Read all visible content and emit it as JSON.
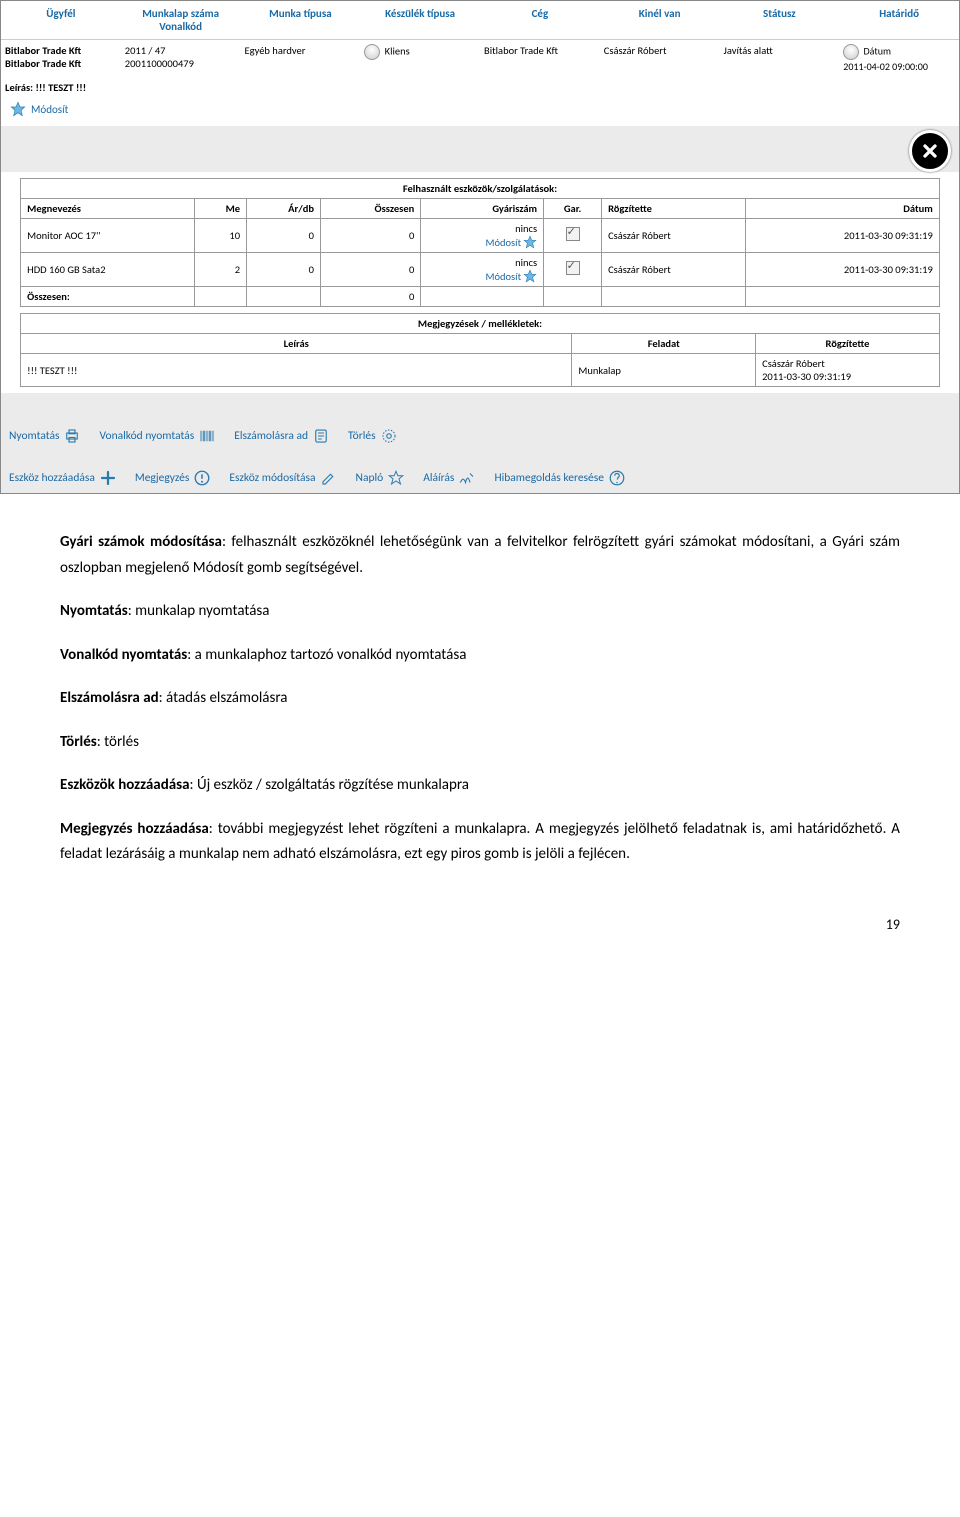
{
  "headers": {
    "c1": "Ügyfél",
    "c2": "Munkalap száma",
    "c2b": "Vonalkód",
    "c3": "Munka típusa",
    "c4": "Készülék típusa",
    "c5": "Cég",
    "c6": "Kinél van",
    "c7": "Státusz",
    "c8": "Határidő"
  },
  "row": {
    "ugyfel1": "Bitlabor Trade Kft",
    "ugyfel2": "Bitlabor Trade Kft",
    "mszam": "2011 / 47",
    "vonalkod": "2001100000479",
    "mtipus": "Egyéb hardver",
    "keszulek": "Kliens",
    "ceg": "Bitlabor Trade Kft",
    "kinel": "Császár Róbert",
    "statusz": "Javítás alatt",
    "datum_label": "Dátum",
    "datum": "2011-04-02 09:00:00"
  },
  "leiras_label": "Leírás: !!! TESZT !!!",
  "modosit_label": "Módosít",
  "tools_table": {
    "title": "Felhasznált eszközök/szolgálatások:",
    "cols": {
      "megnevezes": "Megnevezés",
      "me": "Me",
      "ardb": "Ár/db",
      "osszesen": "Összesen",
      "gyariszam": "Gyáriszám",
      "gar": "Gar.",
      "rogzitette": "Rögzítette",
      "datum": "Dátum"
    },
    "rows": [
      {
        "megnevezes": "Monitor AOC 17''",
        "me": "10",
        "ardb": "0",
        "osszesen": "0",
        "gyariszam": "nincs",
        "rogzitette": "Császár Róbert",
        "datum": "2011-03-30 09:31:19"
      },
      {
        "megnevezes": "HDD 160 GB Sata2",
        "me": "2",
        "ardb": "0",
        "osszesen": "0",
        "gyariszam": "nincs",
        "rogzitette": "Császár Róbert",
        "datum": "2011-03-30 09:31:19"
      }
    ],
    "sum_label": "Összesen:",
    "sum_val": "0",
    "modosit": "Módosít"
  },
  "notes_table": {
    "title": "Megjegyzések / mellékletek:",
    "cols": {
      "leiras": "Leírás",
      "feladat": "Feladat",
      "rogzitette": "Rögzítette"
    },
    "row": {
      "leiras": "!!! TESZT !!!",
      "feladat": "Munkalap",
      "rogzitette": "Császár Róbert",
      "datum": "2011-03-30 09:31:19"
    }
  },
  "actions": {
    "nyomtatas": "Nyomtatás",
    "vonalkod": "Vonalkód nyomtatás",
    "elszamolasra": "Elszámolásra ad",
    "torles": "Törlés",
    "eszkoz_hozzaad": "Eszköz hozzáadása",
    "megjegyzes": "Megjegyzés",
    "eszkoz_modosit": "Eszköz módosítása",
    "naplo": "Napló",
    "alairas": "Aláírás",
    "hibamegoldas": "Hibamegoldás keresése"
  },
  "doc": {
    "p1_bold": "Gyári számok módosítása",
    "p1_rest": ": felhasznált eszközöknél lehetőségünk van a felvitelkor felrögzített gyári számokat módosítani, a Gyári szám oszlopban megjelenő Módosít gomb segítségével.",
    "p2_bold": "Nyomtatás",
    "p2_rest": ": munkalap nyomtatása",
    "p3_bold": "Vonalkód nyomtatás",
    "p3_rest": ": a munkalaphoz tartozó vonalkód nyomtatása",
    "p4_bold": "Elszámolásra ad",
    "p4_rest": ": átadás elszámolásra",
    "p5_bold": "Törlés",
    "p5_rest": ": törlés",
    "p6_bold": "Eszközök hozzáadása",
    "p6_rest": ": Új eszköz / szolgáltatás rögzítése munkalapra",
    "p7_bold": "Megjegyzés hozzáadása",
    "p7_rest": ": további megjegyzést  lehet rögzíteni a munkalapra.  A megjegyzés jelölhető feladatnak is, ami határidőzhető. A feladat lezárásáig a munkalap nem adható elszámolásra, ezt egy piros gomb is jelöli a fejlécen.",
    "page": "19"
  }
}
